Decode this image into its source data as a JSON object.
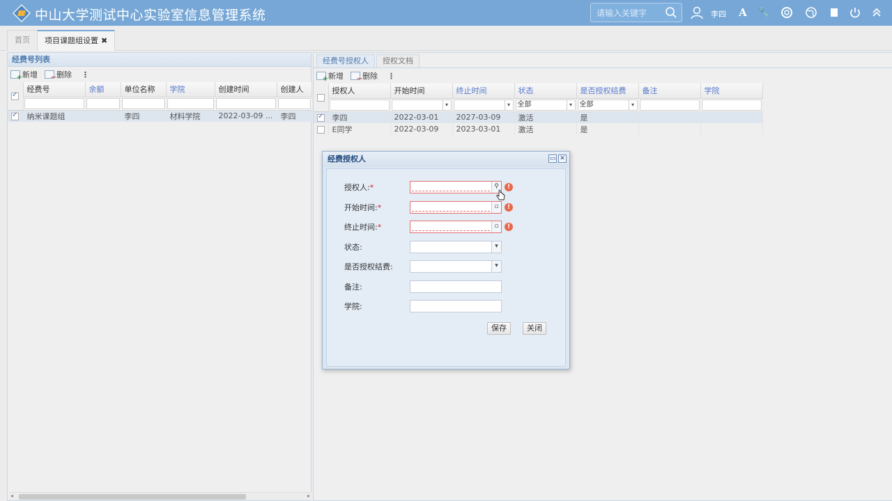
{
  "app": {
    "title": "中山大学测试中心实验室信息管理系统",
    "search_placeholder": "请输入关键字",
    "username": "李四"
  },
  "tabs": [
    {
      "label": "首页"
    },
    {
      "label": "项目课题组设置",
      "close": "✖"
    }
  ],
  "left_panel": {
    "title": "经费号列表",
    "toolbar": {
      "add": "新增",
      "delete": "删除",
      "more": "⋮"
    },
    "columns": [
      "经费号",
      "余额",
      "单位名称",
      "学院",
      "创建时间",
      "创建人"
    ],
    "rows": [
      {
        "checked": true,
        "cells": [
          "纳米课题组",
          "",
          "李四",
          "材料学院",
          "2022-03-09 ...",
          "李四"
        ]
      }
    ]
  },
  "right_panel": {
    "tabs": [
      "经费号授权人",
      "授权文档"
    ],
    "toolbar": {
      "add": "新增",
      "delete": "删除",
      "more": "⋮"
    },
    "columns": [
      "授权人",
      "开始时间",
      "终止时间",
      "状态",
      "是否授权结费",
      "备注",
      "学院"
    ],
    "filters": {
      "status": "全部",
      "auth": "全部"
    },
    "rows": [
      {
        "checked": true,
        "cells": [
          "李四",
          "2022-03-01",
          "2027-03-09",
          "激活",
          "是",
          "",
          ""
        ]
      },
      {
        "checked": false,
        "cells": [
          "E同学",
          "2022-03-09",
          "2023-03-01",
          "激活",
          "是",
          "",
          ""
        ]
      }
    ]
  },
  "dialog": {
    "title": "经费授权人",
    "fields": {
      "auth_person": "授权人:",
      "start_time": "开始时间:",
      "end_time": "终止时间:",
      "status": "状态:",
      "is_auth": "是否授权结费:",
      "remark": "备注:",
      "college": "学院:"
    },
    "required_mark": "*",
    "save": "保存",
    "close": "关闭"
  }
}
